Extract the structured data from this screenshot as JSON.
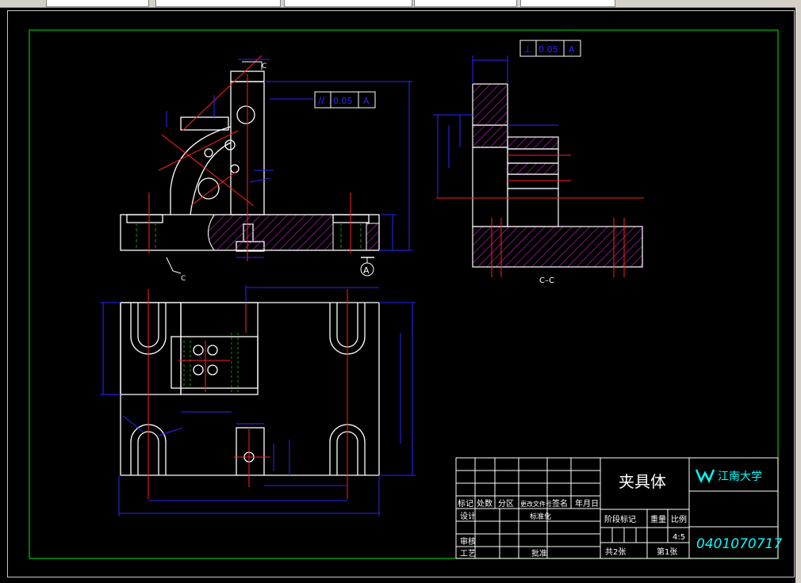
{
  "app": {
    "toolbar_fields": [
      "",
      "",
      "",
      "",
      "",
      ""
    ]
  },
  "drawing": {
    "section_label": "C–C",
    "cut_label_top": "C",
    "cut_label_bottom": "C",
    "datum_label": "A",
    "gdt_parallel": {
      "symbol": "//",
      "value": "0.05",
      "datum": "A"
    },
    "gdt_perpendicular": {
      "symbol": "⊥",
      "value": "0.05",
      "datum": "A"
    }
  },
  "title_block": {
    "part_name": "夹具体",
    "school": "江南大学",
    "drawing_number": "0401070717",
    "scale": "4:5",
    "sheet_total": "共2张",
    "sheet_no": "第1张",
    "headers": {
      "mark": "标记",
      "count": "处数",
      "zone": "分区",
      "change_doc": "更改文件号",
      "signature": "签名",
      "date": "年月日",
      "design": "设计",
      "standardization": "标准化",
      "stage_mark": "阶段标记",
      "weight": "重量",
      "ratio": "比例",
      "review": "审核",
      "process": "工艺",
      "approve": "批准"
    }
  },
  "colors": {
    "border": "#00c000",
    "outline": "#ffffff",
    "dimension": "#2828ff",
    "center": "#ff2020",
    "hatch": "#d020d0",
    "hidden": "#00a000",
    "title_text": "#00ffff"
  }
}
